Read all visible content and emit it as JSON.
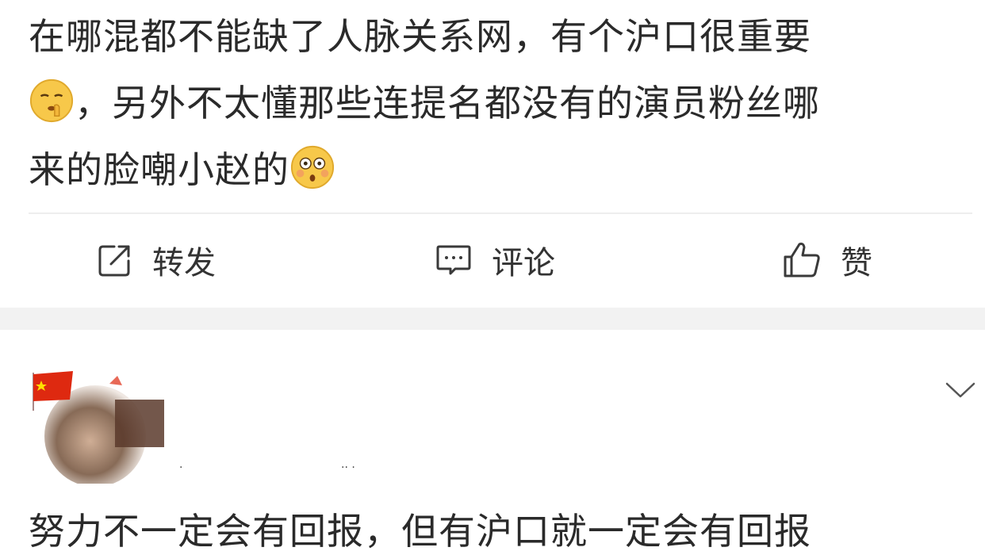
{
  "post": {
    "line1": "在哪混都不能缺了人脉关系网，有个沪口很重要",
    "line2": "，另外不太懂那些连提名都没有的演员粉丝哪",
    "line3": "来的脸嘲小赵的",
    "emoji_1": "shush-face-emoji",
    "emoji_2": "flushed-face-emoji"
  },
  "actions": {
    "repost_label": "转发",
    "comment_label": "评论",
    "like_label": "赞"
  },
  "comment": {
    "partial_text": "努力不一定会有回报，但有沪口就一定会有回报"
  },
  "colors": {
    "text": "#2a2a2a",
    "icon": "#3a3a3a",
    "separator": "#f2f2f2",
    "flag_red": "#de2910"
  }
}
